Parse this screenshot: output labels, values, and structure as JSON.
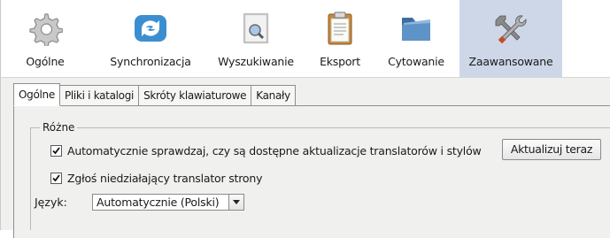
{
  "toolbar": {
    "items": [
      {
        "label": "Ogólne",
        "icon": "gear-icon"
      },
      {
        "label": "Synchronizacja",
        "icon": "sync-arrows-icon"
      },
      {
        "label": "Wyszukiwanie",
        "icon": "document-magnifier-icon"
      },
      {
        "label": "Eksport",
        "icon": "clipboard-icon"
      },
      {
        "label": "Cytowanie",
        "icon": "folder-icon"
      },
      {
        "label": "Zaawansowane",
        "icon": "tools-wrench-screwdriver-icon"
      }
    ],
    "active_index": 5,
    "active_color": "#cdd7e8"
  },
  "tabs": [
    {
      "label": "Ogólne",
      "active": true
    },
    {
      "label": "Pliki i katalogi",
      "active": false
    },
    {
      "label": "Skróty klawiaturowe",
      "active": false
    },
    {
      "label": "Kanały",
      "active": false
    }
  ],
  "group": {
    "title": "Różne",
    "auto_update": {
      "label": "Automatycznie sprawdzaj, czy są dostępne aktualizacje translatorów i stylów",
      "checked": true
    },
    "update_now_button": "Aktualizuj teraz",
    "report_broken": {
      "label": "Zgłoś niedziałający translator strony",
      "checked": true
    },
    "language": {
      "label": "Język:",
      "selected": "Automatycznie (Polski)"
    }
  }
}
